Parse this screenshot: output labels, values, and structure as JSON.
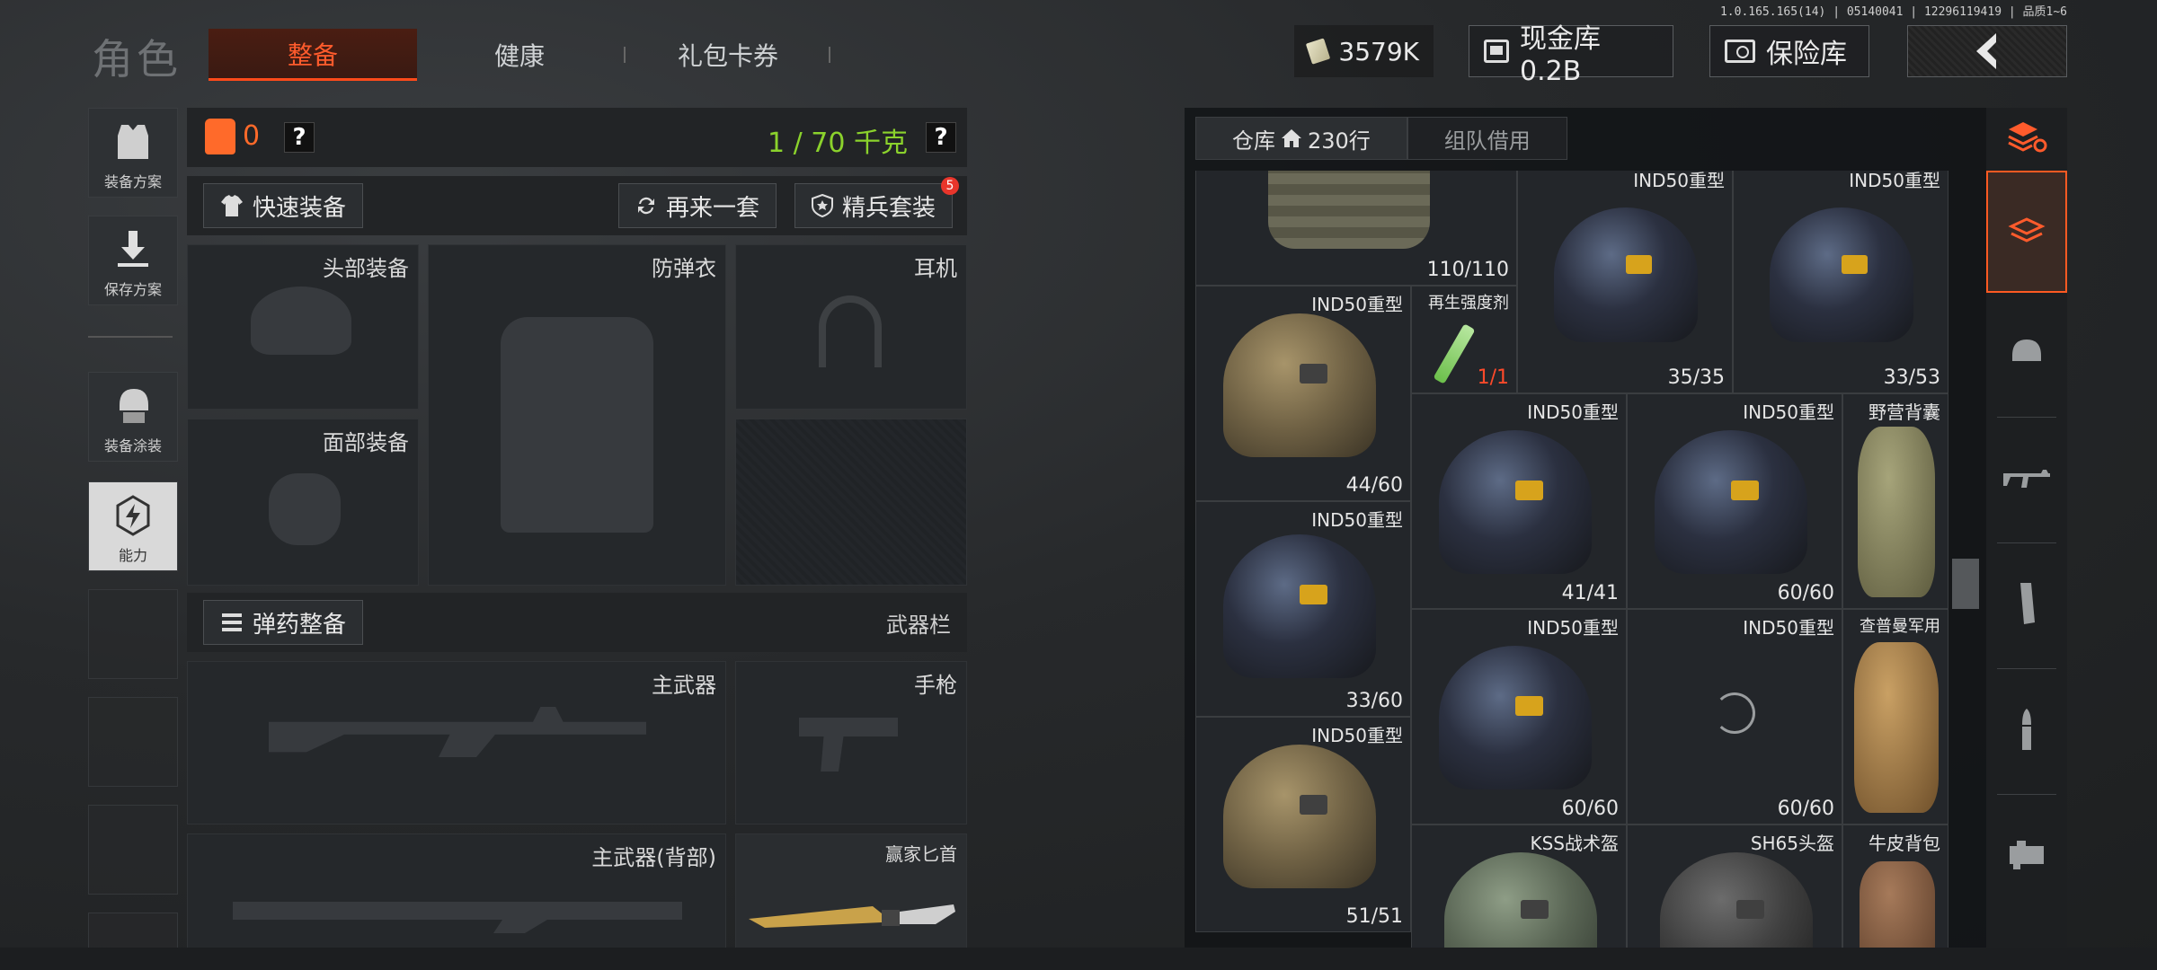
{
  "version": "1.0.165.165(14) | 05140041 | 12296119419 | 品质1~6",
  "header": {
    "role_title": "角色",
    "tabs": [
      "整备",
      "健康",
      "礼包卡券"
    ],
    "money": "3579K",
    "cash_vault": "现金库 0.2B",
    "safe": "保险库"
  },
  "sidebar": [
    "装备方案",
    "保存方案",
    "装备涂装",
    "能力"
  ],
  "equip": {
    "vest_count": "0",
    "help": "?",
    "weight": "1 / 70 千克",
    "quick_equip": "快速装备",
    "another_set": "再来一套",
    "elite_set": "精兵套装",
    "elite_badge": "5",
    "slots": {
      "head": "头部装备",
      "armor": "防弹衣",
      "headset": "耳机",
      "face": "面部装备",
      "main_weapon": "主武器",
      "pistol": "手枪",
      "back_weapon": "主武器(背部)",
      "knife": "赢家匕首"
    },
    "ammo": "弹药整备",
    "weapon_bar": "武器栏"
  },
  "storage": {
    "tab_warehouse": "仓库",
    "rows": "230行",
    "tab_team": "组队借用",
    "items": [
      {
        "name": "",
        "count": "110/110"
      },
      {
        "name": "IND50重型",
        "count": "35/35"
      },
      {
        "name": "IND50重型",
        "count": "33/53"
      },
      {
        "name": "IND50重型",
        "count": "44/60"
      },
      {
        "name": "再生强度剂",
        "count": "1/1"
      },
      {
        "name": "IND50重型",
        "count": "41/41"
      },
      {
        "name": "IND50重型",
        "count": "60/60"
      },
      {
        "name": "野营背囊",
        "count": ""
      },
      {
        "name": "IND50重型",
        "count": "33/60"
      },
      {
        "name": "IND50重型",
        "count": "60/60"
      },
      {
        "name": "IND50重型",
        "count": "60/60"
      },
      {
        "name": "查普曼军用",
        "count": ""
      },
      {
        "name": "IND50重型",
        "count": "51/51"
      },
      {
        "name": "KSS战术盔",
        "count": ""
      },
      {
        "name": "SH65头盔",
        "count": ""
      },
      {
        "name": "牛皮背包",
        "count": ""
      }
    ]
  },
  "colors": {
    "accent": "#ff5b2c",
    "weight_green": "#8bd22c",
    "badge_red": "#e8352b"
  }
}
